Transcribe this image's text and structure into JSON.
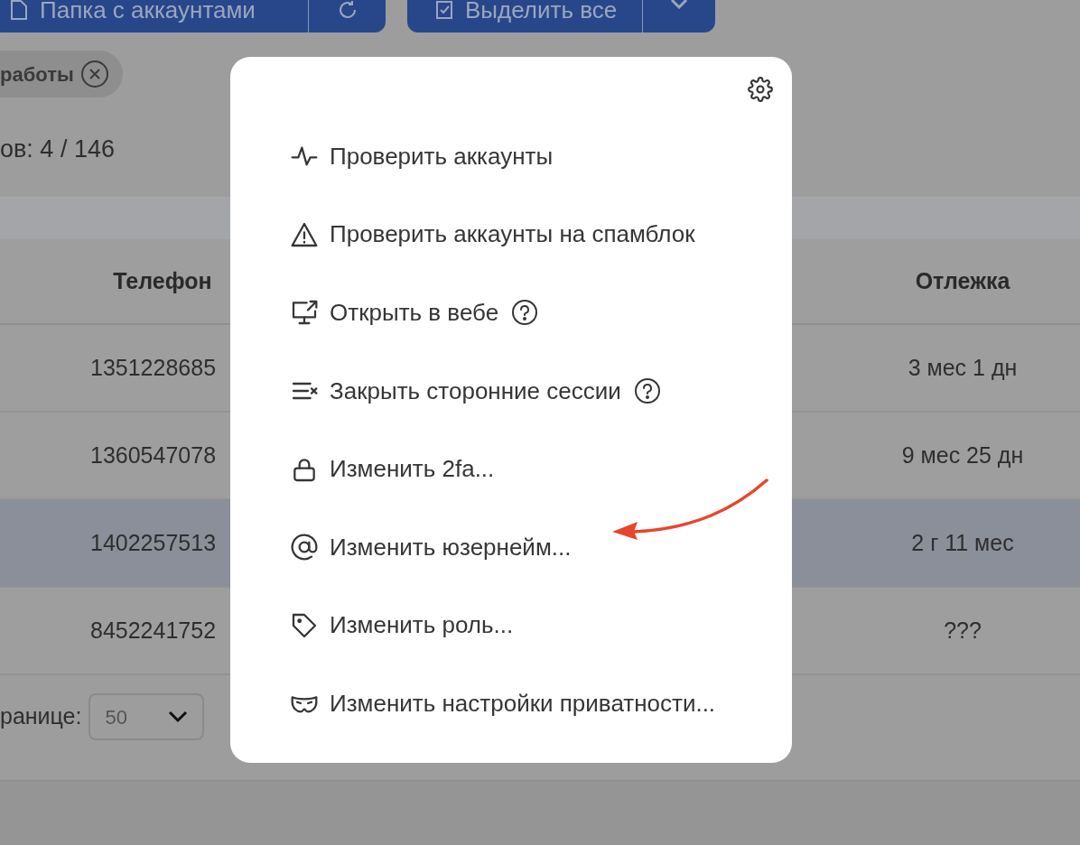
{
  "toolbar": {
    "folder_button": {
      "label": "Папка с аккаунтами"
    },
    "select_all_button": {
      "label": "Выделить все"
    }
  },
  "filter_chip": {
    "label": "работы"
  },
  "counter": "ов: 4 / 146",
  "table": {
    "columns": [
      "Телефон",
      "Отлежка"
    ],
    "rows": [
      {
        "phone": "1351228685",
        "age": "3 мес 1 дн",
        "selected": false
      },
      {
        "phone": "1360547078",
        "age": "9 мес 25 дн",
        "selected": false
      },
      {
        "phone": "1402257513",
        "age": "2 г 11 мес",
        "selected": true
      },
      {
        "phone": "8452241752",
        "age": "???",
        "selected": false
      }
    ]
  },
  "pagination": {
    "label": "ранице:",
    "per_page": "50"
  },
  "menu": {
    "items": [
      {
        "kind": "pulse",
        "label": "Проверить аккаунты",
        "help": false
      },
      {
        "kind": "warning",
        "label": "Проверить аккаунты на спамблок",
        "help": false
      },
      {
        "kind": "monitor",
        "label": "Открыть в вебе",
        "help": true
      },
      {
        "kind": "close-list",
        "label": "Закрыть сторонние сессии",
        "help": true
      },
      {
        "kind": "lock",
        "label": "Изменить 2fa...",
        "help": false
      },
      {
        "kind": "at",
        "label": "Изменить юзернейм...",
        "help": false
      },
      {
        "kind": "tag",
        "label": "Изменить роль...",
        "help": false
      },
      {
        "kind": "mask",
        "label": "Изменить настройки приватности...",
        "help": false
      }
    ]
  }
}
